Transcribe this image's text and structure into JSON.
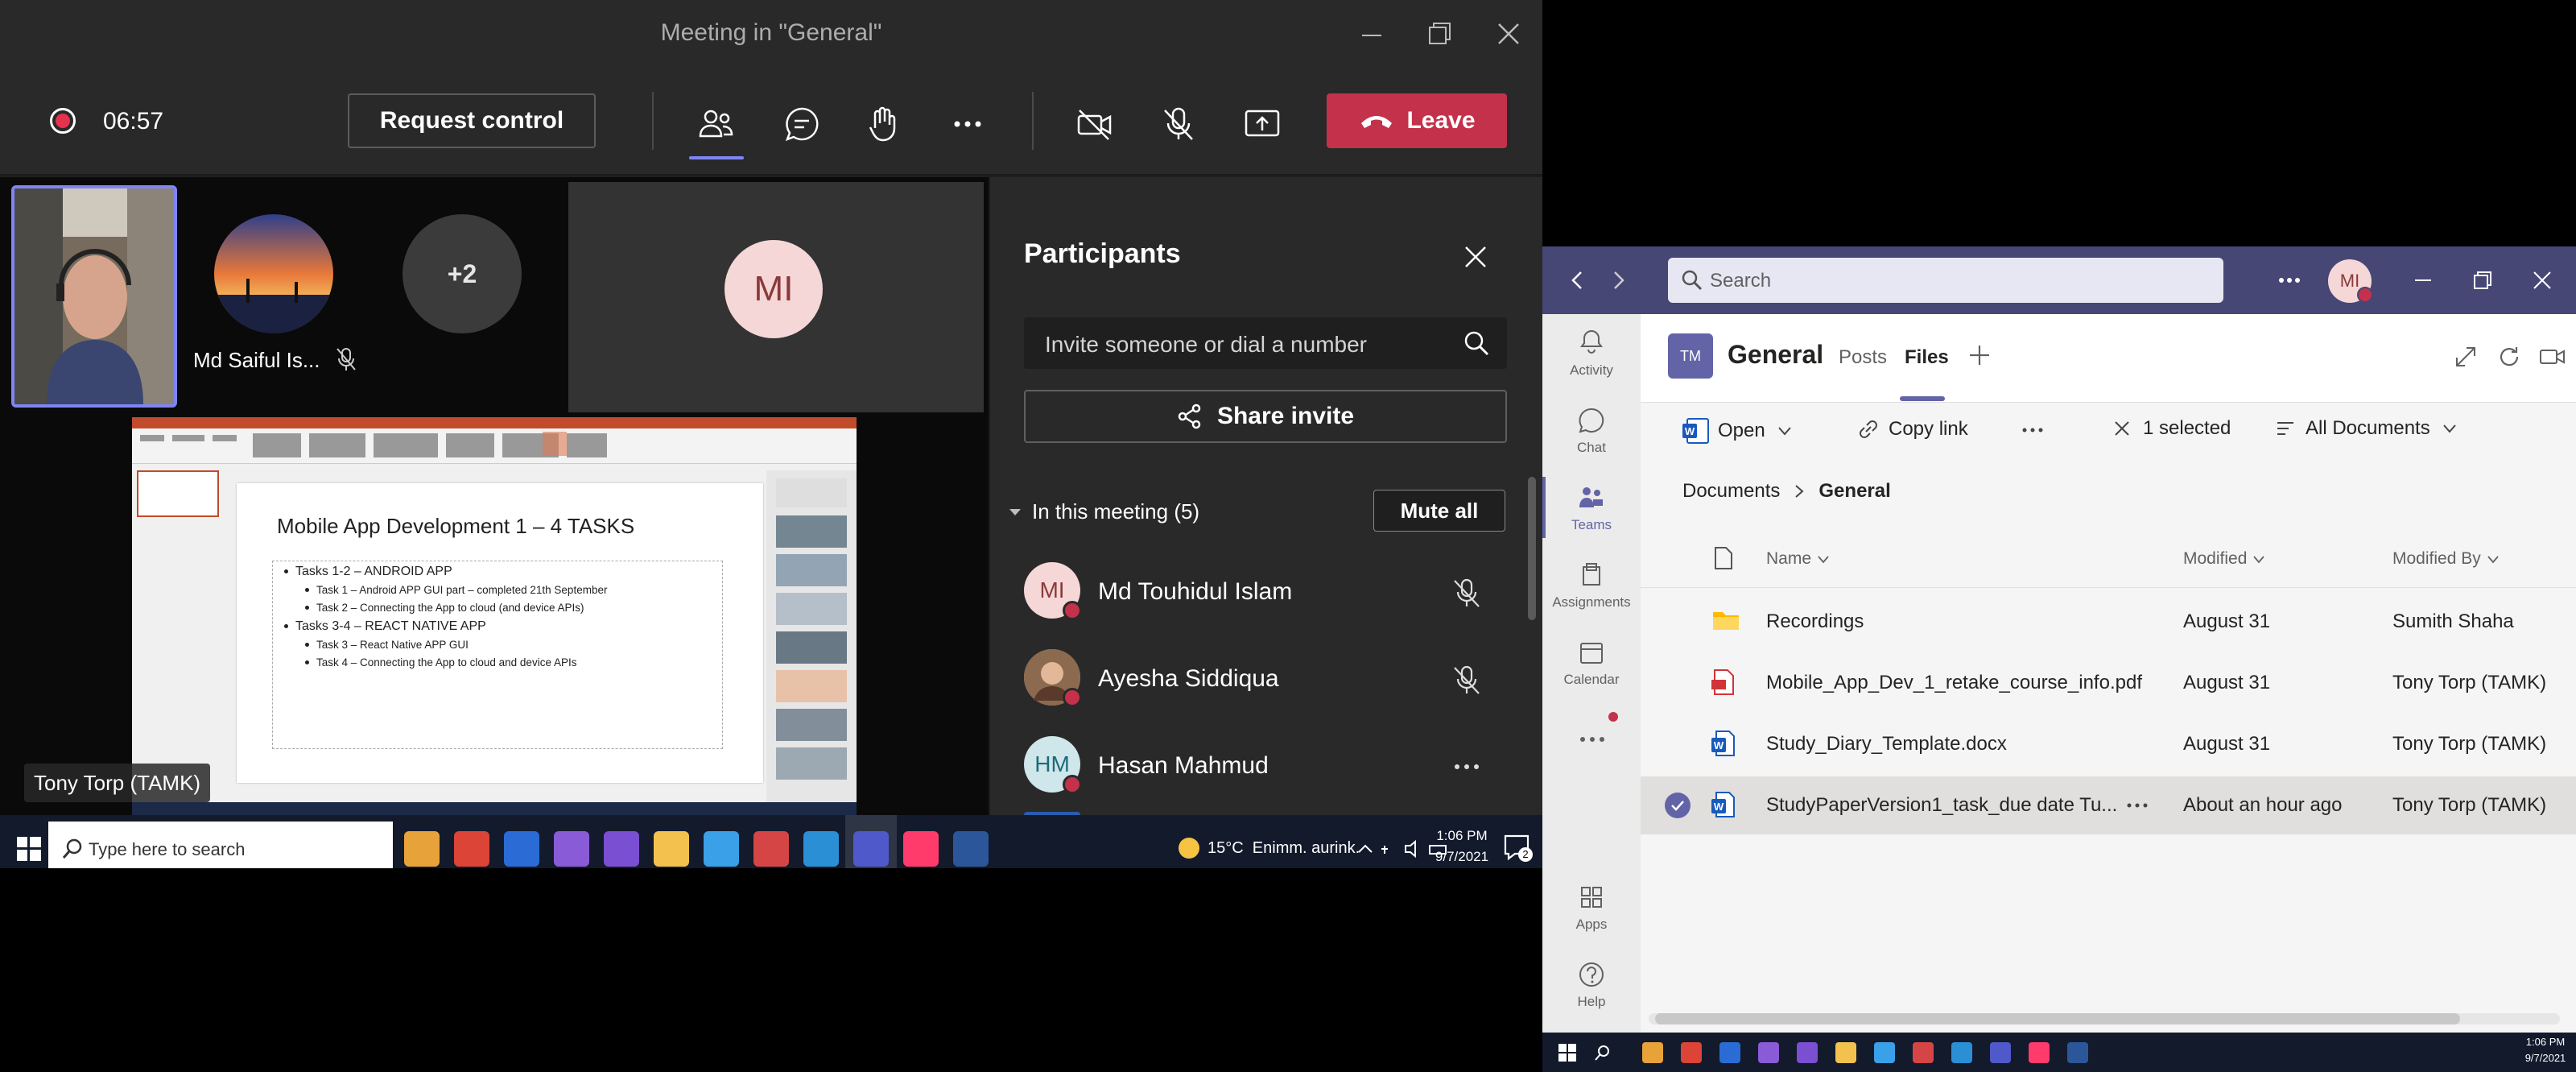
{
  "meeting": {
    "title": "Meeting in \"General\"",
    "timer": "06:57",
    "request_control_label": "Request control",
    "leave_label": "Leave",
    "colors": {
      "leave": "#c4314b",
      "accent": "#6264a7",
      "record": "#e5324d"
    }
  },
  "stage": {
    "tile_name": "Md Saiful Is...",
    "overflow_count": "+2",
    "avatar_initials": "MI",
    "presenter_name": "Tony Torp (TAMK)",
    "slide": {
      "title": "Mobile App Development 1 – 4 TASKS",
      "bullets": [
        {
          "level": 1,
          "text": "Tasks 1-2 – ANDROID APP"
        },
        {
          "level": 2,
          "text": "Task 1 – Android APP GUI part – completed 21th September"
        },
        {
          "level": 2,
          "text": "Task 2 – Connecting the App to cloud (and device APIs)"
        },
        {
          "level": 1,
          "text": "Tasks 3-4 – REACT NATIVE APP"
        },
        {
          "level": 2,
          "text": "Task 3 – React Native APP GUI"
        },
        {
          "level": 2,
          "text": "Task 4 – Connecting the App to cloud and device APIs"
        }
      ]
    }
  },
  "participants": {
    "header": "Participants",
    "invite_placeholder": "Invite someone or dial a number",
    "share_invite_label": "Share invite",
    "section_label": "In this meeting (5)",
    "mute_all_label": "Mute all",
    "people": [
      {
        "name": "Md Touhidul Islam",
        "initials": "MI",
        "action": "mic-off"
      },
      {
        "name": "Ayesha Siddiqua",
        "initials": "",
        "action": "mic-off"
      },
      {
        "name": "Hasan Mahmud",
        "initials": "HM",
        "action": "more"
      }
    ]
  },
  "taskbar": {
    "search_placeholder": "Type here to search",
    "weather": "15°C  Enimm. aurink.",
    "time": "1:06 PM",
    "date": "9/7/2021",
    "notification_count": "2"
  },
  "teams": {
    "search_placeholder": "Search",
    "user_initials": "MI",
    "rail": [
      {
        "label": "Activity",
        "icon": "bell-icon"
      },
      {
        "label": "Chat",
        "icon": "chat-icon"
      },
      {
        "label": "Teams",
        "icon": "teams-icon"
      },
      {
        "label": "Assignments",
        "icon": "assignments-icon"
      },
      {
        "label": "Calendar",
        "icon": "calendar-icon"
      },
      {
        "label": "Apps",
        "icon": "apps-icon"
      },
      {
        "label": "Help",
        "icon": "help-icon"
      }
    ],
    "channel_badge": "TM",
    "channel_name": "General",
    "tabs": [
      "Posts",
      "Files"
    ],
    "active_tab": "Files",
    "commands": {
      "open": "Open",
      "copy_link": "Copy link",
      "selected": "1 selected",
      "view": "All Documents"
    },
    "breadcrumb": [
      "Documents",
      "General"
    ],
    "columns": [
      "Name",
      "Modified",
      "Modified By"
    ],
    "files": [
      {
        "name": "Recordings",
        "type": "folder",
        "modified": "August 31",
        "modified_by": "Sumith Shaha"
      },
      {
        "name": "Mobile_App_Dev_1_retake_course_info.pdf",
        "type": "pdf",
        "modified": "August 31",
        "modified_by": "Tony Torp (TAMK)"
      },
      {
        "name": "Study_Diary_Template.docx",
        "type": "word",
        "modified": "August 31",
        "modified_by": "Tony Torp (TAMK)"
      },
      {
        "name": "StudyPaperVersion1_task_due date Tu...",
        "type": "word",
        "modified": "About an hour ago",
        "modified_by": "Tony Torp (TAMK)",
        "selected": true
      }
    ],
    "taskbar_time": "1:06 PM",
    "taskbar_date": "9/7/2021"
  }
}
